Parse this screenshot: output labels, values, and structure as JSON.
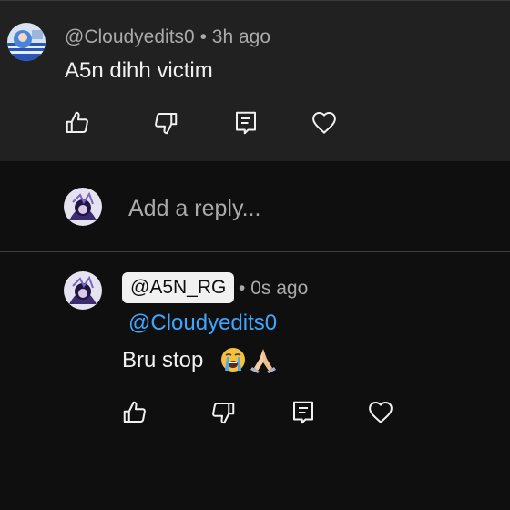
{
  "top_comment": {
    "author": "@Cloudyedits0",
    "separator": "•",
    "time": "3h ago",
    "text": "A5n dihh victim",
    "actions": [
      "like-icon",
      "dislike-icon",
      "reply-icon",
      "heart-icon"
    ]
  },
  "reply_box": {
    "placeholder": "Add a reply..."
  },
  "reply": {
    "author": "@A5N_RG",
    "separator": "•",
    "time": "0s ago",
    "mention": "@Cloudyedits0",
    "text": "Bru stop",
    "emojis": [
      "loudly-crying-face-emoji",
      "folded-hands-emoji"
    ],
    "actions": [
      "like-icon",
      "dislike-icon",
      "reply-icon",
      "heart-icon"
    ]
  },
  "colors": {
    "top_bg": "#212121",
    "page_bg": "#0f0f0f",
    "link": "#3ea6ff",
    "muted": "#aaaaaa",
    "text": "#f1f1f1"
  }
}
